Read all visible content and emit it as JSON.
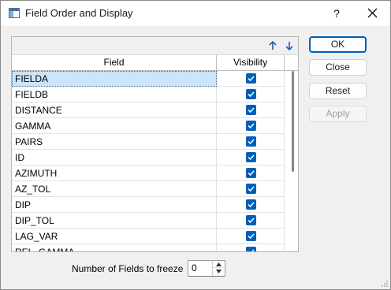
{
  "window": {
    "title": "Field Order and Display",
    "help_label": "?"
  },
  "grid": {
    "columns": {
      "field": "Field",
      "visibility": "Visibility"
    },
    "rows": [
      {
        "field": "FIELDA",
        "visible": true,
        "selected": true
      },
      {
        "field": "FIELDB",
        "visible": true
      },
      {
        "field": "DISTANCE",
        "visible": true
      },
      {
        "field": "GAMMA",
        "visible": true
      },
      {
        "field": "PAIRS",
        "visible": true
      },
      {
        "field": "ID",
        "visible": true
      },
      {
        "field": "AZIMUTH",
        "visible": true
      },
      {
        "field": "AZ_TOL",
        "visible": true
      },
      {
        "field": "DIP",
        "visible": true
      },
      {
        "field": "DIP_TOL",
        "visible": true
      },
      {
        "field": "LAG_VAR",
        "visible": true
      },
      {
        "field": "REL_GAMMA",
        "visible": true
      }
    ]
  },
  "buttons": {
    "ok": "OK",
    "close": "Close",
    "reset": "Reset",
    "apply": "Apply"
  },
  "freeze": {
    "label": "Number of Fields to freeze",
    "value": "0"
  },
  "colors": {
    "accent": "#005fb8",
    "selection": "#cce4f7"
  }
}
